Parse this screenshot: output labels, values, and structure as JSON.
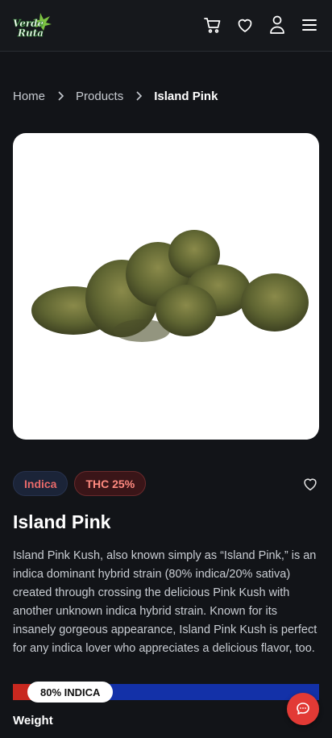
{
  "header": {
    "logo_text_top": "Verde",
    "logo_text_bottom": "Ruta",
    "icons": [
      "cart-icon",
      "heart-icon",
      "user-icon",
      "menu-icon"
    ]
  },
  "breadcrumb": {
    "items": [
      "Home",
      "Products",
      "Island Pink"
    ]
  },
  "product": {
    "image_alt": "Island Pink",
    "tags": {
      "type": "Indica",
      "thc": "THC 25%"
    },
    "title": "Island Pink",
    "description": "Island Pink Kush, also known simply as “Island Pink,” is an indica dominant hybrid strain (80% indica/20% sativa) created through crossing the delicious Pink Kush with another unknown indica hybrid strain. Known for its insanely gorgeous appearance, Island Pink Kush is perfect for any indica lover who appreciates a delicious flavor, too.",
    "strain": {
      "label": "80% INDICA",
      "indica_percent": 80,
      "sativa_percent": 20
    },
    "weight_label": "Weight"
  },
  "colors": {
    "background": "#121418",
    "indica": "#1331a8",
    "sativa": "#c8281f",
    "chat": "#e23a35"
  }
}
